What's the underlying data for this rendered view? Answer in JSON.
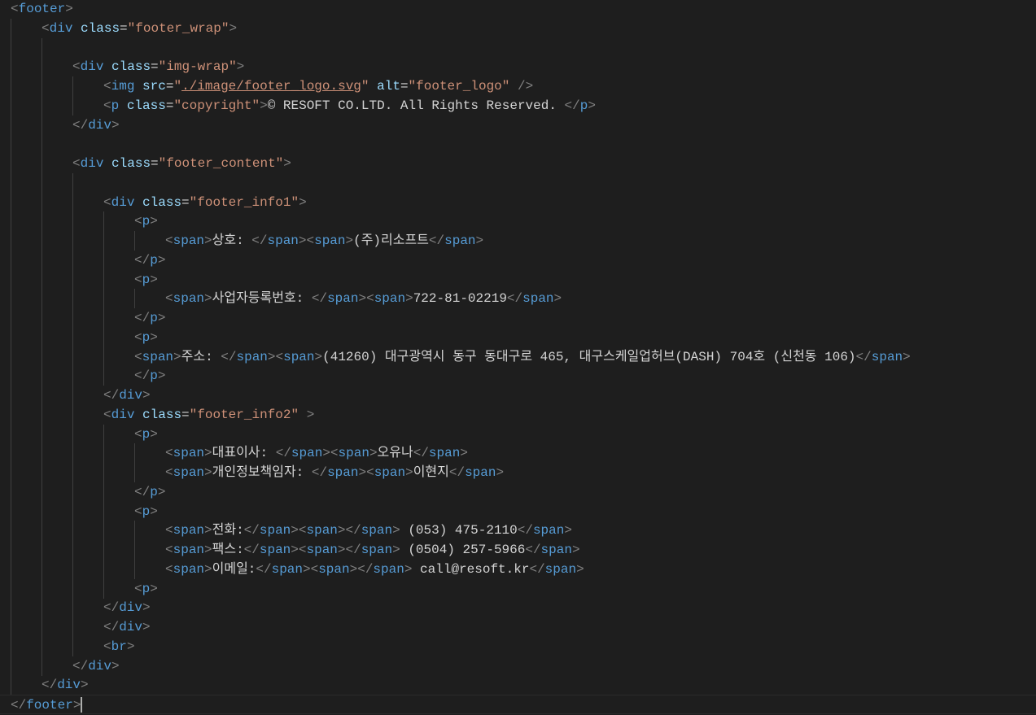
{
  "editor": {
    "language": "html",
    "colors": {
      "background": "#1e1e1e",
      "punctuation": "#808080",
      "tag": "#569cd6",
      "attribute": "#9cdcfe",
      "string": "#ce9178",
      "text": "#d4d4d4"
    },
    "lines": [
      {
        "indent": 0,
        "tokens": [
          [
            "p",
            "<"
          ],
          [
            "t",
            "footer"
          ],
          [
            "p",
            ">"
          ]
        ]
      },
      {
        "indent": 1,
        "tokens": [
          [
            "p",
            "<"
          ],
          [
            "t",
            "div"
          ],
          [
            "x",
            " "
          ],
          [
            "a",
            "class"
          ],
          [
            "x",
            "="
          ],
          [
            "s",
            "\"footer_wrap\""
          ],
          [
            "p",
            ">"
          ]
        ]
      },
      {
        "indent": 2,
        "tokens": []
      },
      {
        "indent": 2,
        "tokens": [
          [
            "p",
            "<"
          ],
          [
            "t",
            "div"
          ],
          [
            "x",
            " "
          ],
          [
            "a",
            "class"
          ],
          [
            "x",
            "="
          ],
          [
            "s",
            "\"img-wrap\""
          ],
          [
            "p",
            ">"
          ]
        ]
      },
      {
        "indent": 3,
        "tokens": [
          [
            "p",
            "<"
          ],
          [
            "t",
            "img"
          ],
          [
            "x",
            " "
          ],
          [
            "a",
            "src"
          ],
          [
            "x",
            "="
          ],
          [
            "s",
            "\""
          ],
          [
            "u",
            "./image/footer_logo.svg"
          ],
          [
            "s",
            "\""
          ],
          [
            "x",
            " "
          ],
          [
            "a",
            "alt"
          ],
          [
            "x",
            "="
          ],
          [
            "s",
            "\"footer_logo\""
          ],
          [
            "x",
            " "
          ],
          [
            "p",
            "/>"
          ]
        ]
      },
      {
        "indent": 3,
        "tokens": [
          [
            "p",
            "<"
          ],
          [
            "t",
            "p"
          ],
          [
            "x",
            " "
          ],
          [
            "a",
            "class"
          ],
          [
            "x",
            "="
          ],
          [
            "s",
            "\"copyright\""
          ],
          [
            "p",
            ">"
          ],
          [
            "x",
            "© RESOFT CO.LTD. All Rights Reserved. "
          ],
          [
            "p",
            "</"
          ],
          [
            "t",
            "p"
          ],
          [
            "p",
            ">"
          ]
        ]
      },
      {
        "indent": 2,
        "tokens": [
          [
            "p",
            "</"
          ],
          [
            "t",
            "div"
          ],
          [
            "p",
            ">"
          ]
        ]
      },
      {
        "indent": 2,
        "tokens": []
      },
      {
        "indent": 2,
        "tokens": [
          [
            "p",
            "<"
          ],
          [
            "t",
            "div"
          ],
          [
            "x",
            " "
          ],
          [
            "a",
            "class"
          ],
          [
            "x",
            "="
          ],
          [
            "s",
            "\"footer_content\""
          ],
          [
            "p",
            ">"
          ]
        ]
      },
      {
        "indent": 3,
        "tokens": []
      },
      {
        "indent": 3,
        "tokens": [
          [
            "p",
            "<"
          ],
          [
            "t",
            "div"
          ],
          [
            "x",
            " "
          ],
          [
            "a",
            "class"
          ],
          [
            "x",
            "="
          ],
          [
            "s",
            "\"footer_info1\""
          ],
          [
            "p",
            ">"
          ]
        ]
      },
      {
        "indent": 4,
        "tokens": [
          [
            "p",
            "<"
          ],
          [
            "t",
            "p"
          ],
          [
            "p",
            ">"
          ]
        ]
      },
      {
        "indent": 5,
        "tokens": [
          [
            "p",
            "<"
          ],
          [
            "t",
            "span"
          ],
          [
            "p",
            ">"
          ],
          [
            "x",
            "상호: "
          ],
          [
            "p",
            "</"
          ],
          [
            "t",
            "span"
          ],
          [
            "p",
            "><"
          ],
          [
            "t",
            "span"
          ],
          [
            "p",
            ">"
          ],
          [
            "x",
            "(주)리소프트"
          ],
          [
            "p",
            "</"
          ],
          [
            "t",
            "span"
          ],
          [
            "p",
            ">"
          ]
        ]
      },
      {
        "indent": 4,
        "tokens": [
          [
            "p",
            "</"
          ],
          [
            "t",
            "p"
          ],
          [
            "p",
            ">"
          ]
        ]
      },
      {
        "indent": 4,
        "tokens": [
          [
            "p",
            "<"
          ],
          [
            "t",
            "p"
          ],
          [
            "p",
            ">"
          ]
        ]
      },
      {
        "indent": 5,
        "tokens": [
          [
            "p",
            "<"
          ],
          [
            "t",
            "span"
          ],
          [
            "p",
            ">"
          ],
          [
            "x",
            "사업자등록번호: "
          ],
          [
            "p",
            "</"
          ],
          [
            "t",
            "span"
          ],
          [
            "p",
            "><"
          ],
          [
            "t",
            "span"
          ],
          [
            "p",
            ">"
          ],
          [
            "x",
            "722-81-02219"
          ],
          [
            "p",
            "</"
          ],
          [
            "t",
            "span"
          ],
          [
            "p",
            ">"
          ]
        ]
      },
      {
        "indent": 4,
        "tokens": [
          [
            "p",
            "</"
          ],
          [
            "t",
            "p"
          ],
          [
            "p",
            ">"
          ]
        ]
      },
      {
        "indent": 4,
        "tokens": [
          [
            "p",
            "<"
          ],
          [
            "t",
            "p"
          ],
          [
            "p",
            ">"
          ]
        ]
      },
      {
        "indent": 4,
        "tokens": [
          [
            "p",
            "<"
          ],
          [
            "t",
            "span"
          ],
          [
            "p",
            ">"
          ],
          [
            "x",
            "주소: "
          ],
          [
            "p",
            "</"
          ],
          [
            "t",
            "span"
          ],
          [
            "p",
            "><"
          ],
          [
            "t",
            "span"
          ],
          [
            "p",
            ">"
          ],
          [
            "x",
            "(41260) 대구광역시 동구 동대구로 465, 대구스케일업허브(DASH) 704호 (신천동 106)"
          ],
          [
            "p",
            "</"
          ],
          [
            "t",
            "span"
          ],
          [
            "p",
            ">"
          ]
        ]
      },
      {
        "indent": 4,
        "tokens": [
          [
            "p",
            "</"
          ],
          [
            "t",
            "p"
          ],
          [
            "p",
            ">"
          ]
        ]
      },
      {
        "indent": 3,
        "tokens": [
          [
            "p",
            "</"
          ],
          [
            "t",
            "div"
          ],
          [
            "p",
            ">"
          ]
        ]
      },
      {
        "indent": 3,
        "tokens": [
          [
            "p",
            "<"
          ],
          [
            "t",
            "div"
          ],
          [
            "x",
            " "
          ],
          [
            "a",
            "class"
          ],
          [
            "x",
            "="
          ],
          [
            "s",
            "\"footer_info2\""
          ],
          [
            "x",
            " "
          ],
          [
            "p",
            ">"
          ]
        ]
      },
      {
        "indent": 4,
        "tokens": [
          [
            "p",
            "<"
          ],
          [
            "t",
            "p"
          ],
          [
            "p",
            ">"
          ]
        ]
      },
      {
        "indent": 5,
        "tokens": [
          [
            "p",
            "<"
          ],
          [
            "t",
            "span"
          ],
          [
            "p",
            ">"
          ],
          [
            "x",
            "대표이사: "
          ],
          [
            "p",
            "</"
          ],
          [
            "t",
            "span"
          ],
          [
            "p",
            "><"
          ],
          [
            "t",
            "span"
          ],
          [
            "p",
            ">"
          ],
          [
            "x",
            "오유나"
          ],
          [
            "p",
            "</"
          ],
          [
            "t",
            "span"
          ],
          [
            "p",
            ">"
          ]
        ]
      },
      {
        "indent": 5,
        "tokens": [
          [
            "p",
            "<"
          ],
          [
            "t",
            "span"
          ],
          [
            "p",
            ">"
          ],
          [
            "x",
            "개인정보책임자: "
          ],
          [
            "p",
            "</"
          ],
          [
            "t",
            "span"
          ],
          [
            "p",
            "><"
          ],
          [
            "t",
            "span"
          ],
          [
            "p",
            ">"
          ],
          [
            "x",
            "이현지"
          ],
          [
            "p",
            "</"
          ],
          [
            "t",
            "span"
          ],
          [
            "p",
            ">"
          ]
        ]
      },
      {
        "indent": 4,
        "tokens": [
          [
            "p",
            "</"
          ],
          [
            "t",
            "p"
          ],
          [
            "p",
            ">"
          ]
        ]
      },
      {
        "indent": 4,
        "tokens": [
          [
            "p",
            "<"
          ],
          [
            "t",
            "p"
          ],
          [
            "p",
            ">"
          ]
        ]
      },
      {
        "indent": 5,
        "tokens": [
          [
            "p",
            "<"
          ],
          [
            "t",
            "span"
          ],
          [
            "p",
            ">"
          ],
          [
            "x",
            "전화:"
          ],
          [
            "p",
            "</"
          ],
          [
            "t",
            "span"
          ],
          [
            "p",
            "><"
          ],
          [
            "t",
            "span"
          ],
          [
            "p",
            "></"
          ],
          [
            "t",
            "span"
          ],
          [
            "p",
            ">"
          ],
          [
            "x",
            " (053) 475-2110"
          ],
          [
            "p",
            "</"
          ],
          [
            "t",
            "span"
          ],
          [
            "p",
            ">"
          ]
        ]
      },
      {
        "indent": 5,
        "tokens": [
          [
            "p",
            "<"
          ],
          [
            "t",
            "span"
          ],
          [
            "p",
            ">"
          ],
          [
            "x",
            "팩스:"
          ],
          [
            "p",
            "</"
          ],
          [
            "t",
            "span"
          ],
          [
            "p",
            "><"
          ],
          [
            "t",
            "span"
          ],
          [
            "p",
            "></"
          ],
          [
            "t",
            "span"
          ],
          [
            "p",
            ">"
          ],
          [
            "x",
            " (0504) 257-5966"
          ],
          [
            "p",
            "</"
          ],
          [
            "t",
            "span"
          ],
          [
            "p",
            ">"
          ]
        ]
      },
      {
        "indent": 5,
        "tokens": [
          [
            "p",
            "<"
          ],
          [
            "t",
            "span"
          ],
          [
            "p",
            ">"
          ],
          [
            "x",
            "이메일:"
          ],
          [
            "p",
            "</"
          ],
          [
            "t",
            "span"
          ],
          [
            "p",
            "><"
          ],
          [
            "t",
            "span"
          ],
          [
            "p",
            "></"
          ],
          [
            "t",
            "span"
          ],
          [
            "p",
            ">"
          ],
          [
            "x",
            " call@resoft.kr"
          ],
          [
            "p",
            "</"
          ],
          [
            "t",
            "span"
          ],
          [
            "p",
            ">"
          ]
        ]
      },
      {
        "indent": 4,
        "tokens": [
          [
            "p",
            "<"
          ],
          [
            "t",
            "p"
          ],
          [
            "p",
            ">"
          ]
        ]
      },
      {
        "indent": 3,
        "tokens": [
          [
            "p",
            "</"
          ],
          [
            "t",
            "div"
          ],
          [
            "p",
            ">"
          ]
        ]
      },
      {
        "indent": 3,
        "tokens": [
          [
            "p",
            "</"
          ],
          [
            "t",
            "div"
          ],
          [
            "p",
            ">"
          ]
        ]
      },
      {
        "indent": 3,
        "tokens": [
          [
            "p",
            "<"
          ],
          [
            "t",
            "br"
          ],
          [
            "p",
            ">"
          ]
        ]
      },
      {
        "indent": 2,
        "tokens": [
          [
            "p",
            "</"
          ],
          [
            "t",
            "div"
          ],
          [
            "p",
            ">"
          ]
        ]
      },
      {
        "indent": 1,
        "tokens": [
          [
            "p",
            "</"
          ],
          [
            "t",
            "div"
          ],
          [
            "p",
            ">"
          ]
        ]
      },
      {
        "indent": 0,
        "tokens": [
          [
            "p",
            "</"
          ],
          [
            "t",
            "footer"
          ],
          [
            "p",
            ">"
          ]
        ],
        "current": true
      }
    ]
  }
}
